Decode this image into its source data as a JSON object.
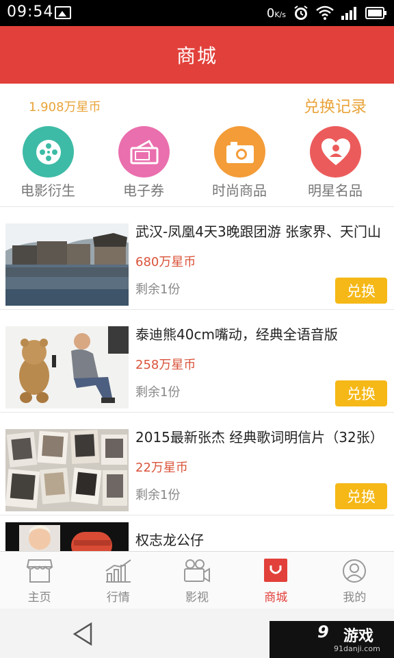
{
  "status_bar": {
    "time": "09:54",
    "net_speed": "0",
    "net_unit": "K/s"
  },
  "header": {
    "title": "商城"
  },
  "balance": {
    "coins": "1.908万星币",
    "history_label": "兑换记录"
  },
  "categories": [
    {
      "label": "电影衍生",
      "icon": "film-reel-icon",
      "color": "#3dbba6"
    },
    {
      "label": "电子券",
      "icon": "ticket-icon",
      "color": "#ea6fae"
    },
    {
      "label": "时尚商品",
      "icon": "camera-icon",
      "color": "#f39c38"
    },
    {
      "label": "明星名品",
      "icon": "heart-person-icon",
      "color": "#ec5b5b"
    }
  ],
  "products": [
    {
      "name": "武汉-凤凰4天3晚跟团游 张家界、天门山",
      "price": "680万星币",
      "remaining": "剩余1份",
      "button": "兑换"
    },
    {
      "name": "泰迪熊40cm嘴动，经典全语音版",
      "price": "258万星币",
      "remaining": "剩余1份",
      "button": "兑换"
    },
    {
      "name": "2015最新张杰 经典歌词明信片（32张）",
      "price": "22万星币",
      "remaining": "剩余1份",
      "button": "兑换"
    },
    {
      "name": "权志龙公仔",
      "price": "",
      "remaining": "",
      "button": ""
    }
  ],
  "tabs": [
    {
      "label": "主页",
      "icon": "storefront-icon",
      "active": false
    },
    {
      "label": "行情",
      "icon": "trend-chart-icon",
      "active": false
    },
    {
      "label": "影视",
      "icon": "video-camera-icon",
      "active": false
    },
    {
      "label": "商城",
      "icon": "shopping-bag-icon",
      "active": true
    },
    {
      "label": "我的",
      "icon": "user-profile-icon",
      "active": false
    }
  ],
  "watermark": {
    "logo": "9",
    "brand": "游戏",
    "url": "91danji.com"
  },
  "colors": {
    "accent": "#e2403a",
    "gold": "#f5b817",
    "price": "#d9533a"
  }
}
